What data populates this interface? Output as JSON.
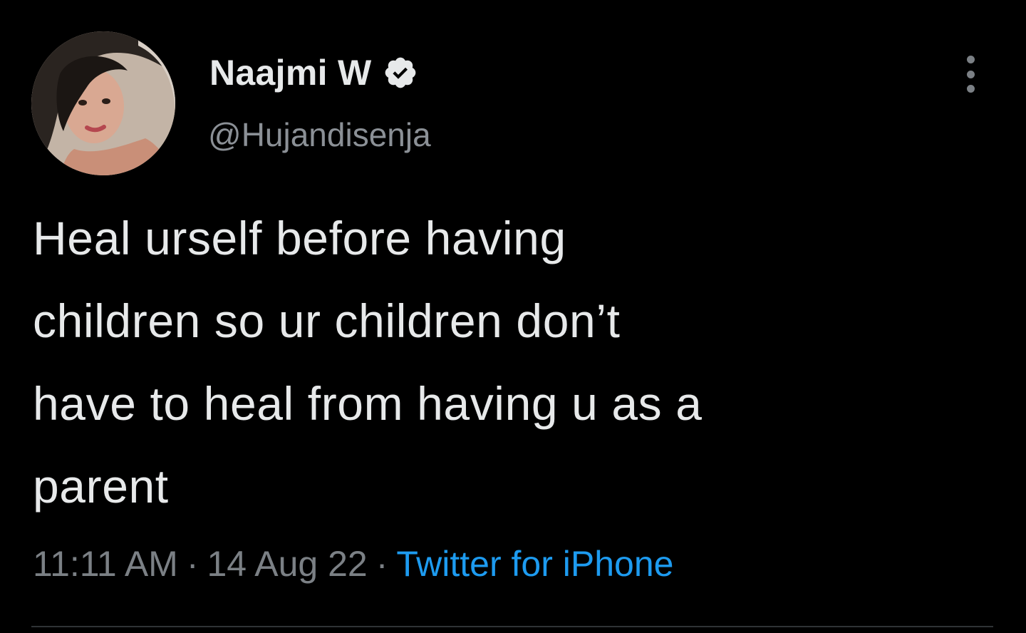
{
  "tweet": {
    "author": {
      "display_name": "Naajmi W",
      "handle": "@Hujandisenja",
      "verified": true,
      "avatar": "profile-photo"
    },
    "text_lines": [
      "Heal urself before having",
      "children so ur children don’t",
      "have to heal from having u as a",
      "parent"
    ],
    "time": "11:11 AM",
    "separator": "·",
    "date": "14 Aug 22",
    "source": "Twitter for iPhone",
    "more_icon": "more-vertical-icon"
  },
  "colors": {
    "background": "#000000",
    "text_primary": "#e7e9ea",
    "text_secondary": "#7b8085",
    "link": "#1d9bf0",
    "divider": "#2f3336"
  }
}
